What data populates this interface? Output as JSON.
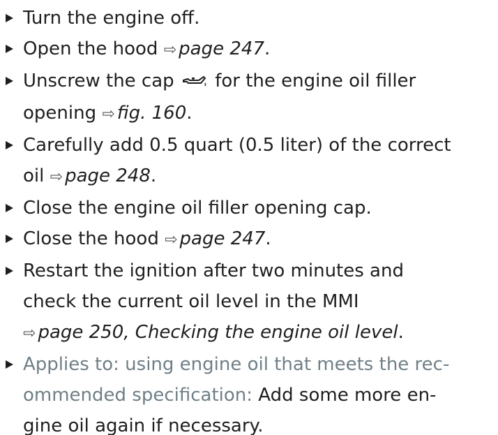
{
  "steps": [
    {
      "text": "Turn the engine off."
    },
    {
      "text": "Open the hood",
      "arrow": "⇨",
      "ref": "page 247",
      "end": "."
    },
    {
      "before": "Unscrew the cap",
      "after": "for the engine oil filler",
      "line2": "opening",
      "arrow": "⇨",
      "ref": "fig. 160",
      "end": ".",
      "icon": "oil-can-icon"
    },
    {
      "text": "Carefully add 0.5 quart (0.5 liter) of the correct",
      "line2": "oil",
      "arrow": "⇨",
      "ref": "page 248",
      "end": "."
    },
    {
      "text": "Close the engine oil filler opening cap."
    },
    {
      "text": "Close the hood",
      "arrow": "⇨",
      "ref": "page 247",
      "end": "."
    },
    {
      "line1": "Restart the ignition after two minutes and",
      "line2": "check the current oil level in the MMI",
      "arrow": "⇨",
      "ref": "page 250, Checking the engine oil level",
      "end": "."
    },
    {
      "muted1": "Applies to: using engine oil that meets the rec-",
      "muted2": "ommended specification:",
      "tail2": " Add some more en-",
      "line3": "gine oil again if necessary."
    }
  ]
}
